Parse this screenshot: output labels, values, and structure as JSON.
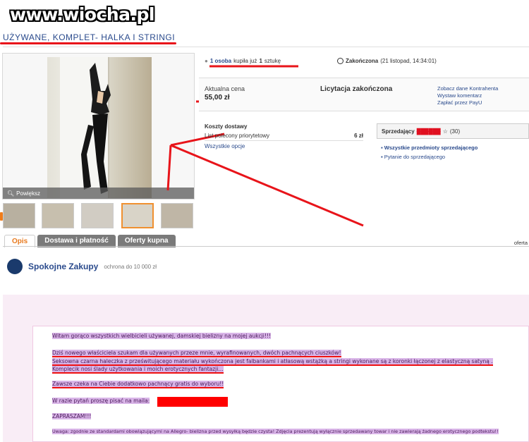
{
  "watermark": "www.wiocha.pl",
  "item": {
    "title": "UŻYWANE, KOMPLET- HALKA I STRINGI",
    "zoom_label": "Powiększ"
  },
  "purchase": {
    "buyers_count_link": "1 osoba",
    "bought_text": "kupiła już",
    "quantity": "1",
    "unit": "sztukę"
  },
  "end": {
    "label": "Zakończona",
    "date": "(21 listopad, 14:34:01)"
  },
  "price": {
    "label": "Aktualna cena",
    "value": "55,00 zł",
    "status": "Licytacja zakończona",
    "links": [
      "Zobacz dane Kontrahenta",
      "Wystaw komentarz",
      "Zapłać przez PayU"
    ]
  },
  "shipping": {
    "heading": "Koszty dostawy",
    "option": "List polecony priorytetowy",
    "cost": "6 zł",
    "all_options": "Wszystkie opcje"
  },
  "seller": {
    "label": "Sprzedający",
    "rating": "(30)",
    "links": [
      "Wszystkie przedmioty sprzedającego",
      "Pytanie do sprzedającego"
    ]
  },
  "tabs": [
    "Opis",
    "Dostawa i płatność",
    "Oferty kupna"
  ],
  "tabs_right": "oferta",
  "safe_buy": {
    "title": "Spokojne Zakupy",
    "subtitle": "ochrona do 10 000 zł"
  },
  "description": [
    "Witam gorąco wszystkich wielbicieli używanej, damskiej bielizny na mojej aukcji!!!",
    "Dziś nowego właściciela szukam dla używanych przeze mnie, wyrafinowanych, dwóch pachnących ciuszków!",
    "Seksowna czarna haleczka z prześwitującego materiału wykończona jest falbankami i atłasową wstążką a stringi wykonane są z koronki łączonej z elastyczną satyną .",
    "Komplecik nosi ślady użytkowania i moich erotycznych fantazji...",
    "Zawsze czeka na Ciebie dodatkowo pachnący gratis do wyboru!!",
    "W razie pytań proszę pisać na maila:",
    "ZAPRASZAM!!!",
    "Uwaga: zgodnie ze standardami obowiązującymi na Allegro- bielizna przed wysyłką będzie czysta! Zdjęcia prezentują wyłącznie sprzedawany towar i nie zawierają żadnego erotycznego podtekstu!!"
  ],
  "colors": {
    "annotation_red": "#e8141a",
    "link_blue": "#2a4a8c",
    "tab_active_orange": "#e87a1e",
    "highlight_lilac": "#d9b5e8"
  }
}
